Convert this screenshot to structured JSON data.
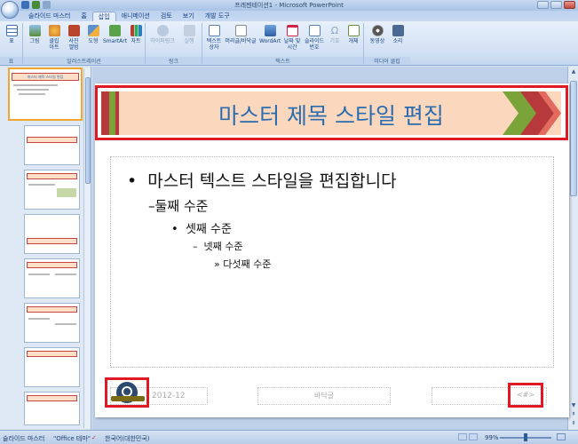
{
  "window": {
    "title": "프레젠테이션1 - Microsoft PowerPoint"
  },
  "tabs": [
    {
      "label": "슬라이드 마스터"
    },
    {
      "label": "홈"
    },
    {
      "label": "삽입"
    },
    {
      "label": "애니메이션"
    },
    {
      "label": "검토"
    },
    {
      "label": "보기"
    },
    {
      "label": "개발 도구"
    }
  ],
  "ribbon": {
    "table_group": {
      "label": "표",
      "buttons": [
        "표"
      ]
    },
    "illustrations_group": {
      "label": "일러스트레이션",
      "buttons": [
        "그림",
        "클립\n아트",
        "사진\n앨범",
        "도형",
        "SmartArt",
        "차트"
      ]
    },
    "links_group": {
      "label": "링크",
      "buttons": [
        "하이퍼링크",
        "실행"
      ]
    },
    "text_group": {
      "label": "텍스트",
      "buttons": [
        "텍스트\n상자",
        "머리글/바닥글",
        "WordArt",
        "날짜 및\n시간",
        "슬라이드\n번호",
        "기호",
        "개체"
      ]
    },
    "media_group": {
      "label": "미디어 클립",
      "buttons": [
        "동영상",
        "소리"
      ]
    }
  },
  "slide": {
    "title": "마스터 제목 스타일 편집",
    "levels": [
      "마스터 텍스트 스타일을 편집합니다",
      "둘째 수준",
      "셋째 수준",
      "넷째 수준",
      "다섯째 수준"
    ],
    "footer_date": "2012-12",
    "footer_text": "바닥글",
    "footer_number": "<#>"
  },
  "thumbnail_master_title": "마스터 제목 스타일 편집",
  "status": {
    "view": "슬라이드 마스터",
    "theme": "\"Office 테마\"",
    "language": "한국어(대한민국)",
    "zoom": "99%"
  },
  "colors": {
    "accent_red": "#e01a24",
    "title_blue": "#2b6cae",
    "banner_peach": "#fbd8bd",
    "banner_green": "#7aa43a"
  }
}
